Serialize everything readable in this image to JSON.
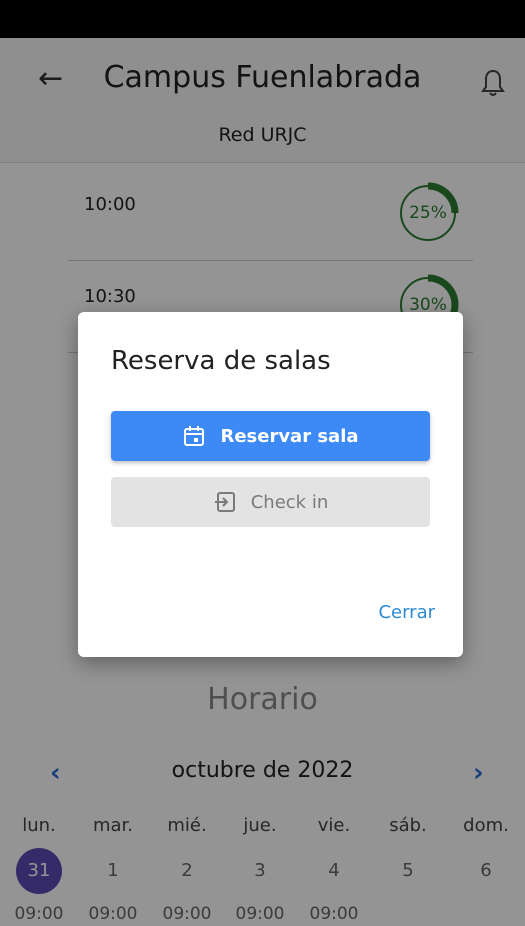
{
  "header": {
    "title": "Campus Fuenlabrada",
    "network": "Red URJC"
  },
  "slots": [
    {
      "time": "10:00",
      "percent": "25%",
      "occupancy": 0.25
    },
    {
      "time": "10:30",
      "percent": "30%",
      "occupancy": 0.3
    }
  ],
  "dialog": {
    "title": "Reserva de salas",
    "reserve_label": "Reservar sala",
    "checkin_label": "Check in",
    "close_label": "Cerrar"
  },
  "schedule": {
    "title": "Horario",
    "month": "octubre de 2022",
    "weekdays": [
      "lun.",
      "mar.",
      "mié.",
      "jue.",
      "vie.",
      "sáb.",
      "dom."
    ],
    "days": [
      "31",
      "1",
      "2",
      "3",
      "4",
      "5",
      "6"
    ],
    "times": [
      "09:00",
      "09:00",
      "09:00",
      "09:00",
      "09:00"
    ]
  },
  "colors": {
    "accent": "#3d8af7",
    "ring_green": "#2e7d32",
    "selected_day": "#5a4bb3",
    "link_blue": "#2a8ad6"
  },
  "icons": {
    "back": "arrow-left-icon",
    "bell": "bell-icon",
    "calendar": "calendar-icon",
    "checkin": "checkin-icon",
    "prev": "chevron-left-icon",
    "next": "chevron-right-icon"
  }
}
